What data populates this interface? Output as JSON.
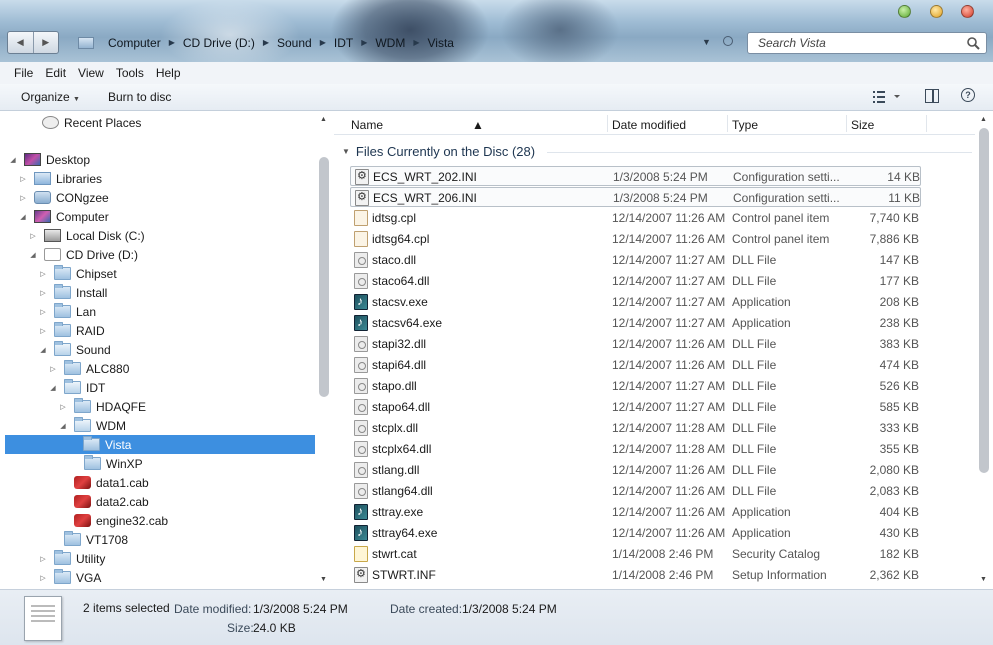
{
  "window": {
    "breadcrumb": [
      "Computer",
      "CD Drive (D:)",
      "Sound",
      "IDT",
      "WDM",
      "Vista"
    ],
    "search_placeholder": "Search Vista"
  },
  "menu": [
    "File",
    "Edit",
    "View",
    "Tools",
    "Help"
  ],
  "toolbar": {
    "organize": "Organize",
    "burn": "Burn to disc"
  },
  "nav": {
    "items": [
      {
        "label": "Recent Places"
      },
      {
        "label": "Desktop"
      },
      {
        "label": "Libraries"
      },
      {
        "label": "CONgzee"
      },
      {
        "label": "Computer"
      },
      {
        "label": "Local Disk (C:)"
      },
      {
        "label": "CD Drive (D:)"
      },
      {
        "label": "Chipset"
      },
      {
        "label": "Install"
      },
      {
        "label": "Lan"
      },
      {
        "label": "RAID"
      },
      {
        "label": "Sound"
      },
      {
        "label": "ALC880"
      },
      {
        "label": "IDT"
      },
      {
        "label": "HDAQFE"
      },
      {
        "label": "WDM"
      },
      {
        "label": "Vista"
      },
      {
        "label": "WinXP"
      },
      {
        "label": "data1.cab"
      },
      {
        "label": "data2.cab"
      },
      {
        "label": "engine32.cab"
      },
      {
        "label": "VT1708"
      },
      {
        "label": "Utility"
      },
      {
        "label": "VGA"
      }
    ]
  },
  "columns": {
    "name": "Name",
    "date": "Date modified",
    "type": "Type",
    "size": "Size"
  },
  "group": {
    "title": "Files Currently on the Disc (28)"
  },
  "files": [
    {
      "name": "ECS_WRT_202.INI",
      "date": "1/3/2008 5:24 PM",
      "type": "Configuration setti...",
      "size": "14 KB",
      "icon": "ini-file-icon"
    },
    {
      "name": "ECS_WRT_206.INI",
      "date": "1/3/2008 5:24 PM",
      "type": "Configuration setti...",
      "size": "11 KB",
      "icon": "ini-file-icon"
    },
    {
      "name": "idtsg.cpl",
      "date": "12/14/2007 11:26 AM",
      "type": "Control panel item",
      "size": "7,740 KB",
      "icon": "cpl-file-icon"
    },
    {
      "name": "idtsg64.cpl",
      "date": "12/14/2007 11:26 AM",
      "type": "Control panel item",
      "size": "7,886 KB",
      "icon": "cpl-file-icon"
    },
    {
      "name": "staco.dll",
      "date": "12/14/2007 11:27 AM",
      "type": "DLL File",
      "size": "147 KB",
      "icon": "dll-file-icon"
    },
    {
      "name": "staco64.dll",
      "date": "12/14/2007 11:27 AM",
      "type": "DLL File",
      "size": "177 KB",
      "icon": "dll-file-icon"
    },
    {
      "name": "stacsv.exe",
      "date": "12/14/2007 11:27 AM",
      "type": "Application",
      "size": "208 KB",
      "icon": "exe-file-icon"
    },
    {
      "name": "stacsv64.exe",
      "date": "12/14/2007 11:27 AM",
      "type": "Application",
      "size": "238 KB",
      "icon": "exe-file-icon"
    },
    {
      "name": "stapi32.dll",
      "date": "12/14/2007 11:26 AM",
      "type": "DLL File",
      "size": "383 KB",
      "icon": "dll-file-icon"
    },
    {
      "name": "stapi64.dll",
      "date": "12/14/2007 11:26 AM",
      "type": "DLL File",
      "size": "474 KB",
      "icon": "dll-file-icon"
    },
    {
      "name": "stapo.dll",
      "date": "12/14/2007 11:27 AM",
      "type": "DLL File",
      "size": "526 KB",
      "icon": "dll-file-icon"
    },
    {
      "name": "stapo64.dll",
      "date": "12/14/2007 11:27 AM",
      "type": "DLL File",
      "size": "585 KB",
      "icon": "dll-file-icon"
    },
    {
      "name": "stcplx.dll",
      "date": "12/14/2007 11:28 AM",
      "type": "DLL File",
      "size": "333 KB",
      "icon": "dll-file-icon"
    },
    {
      "name": "stcplx64.dll",
      "date": "12/14/2007 11:28 AM",
      "type": "DLL File",
      "size": "355 KB",
      "icon": "dll-file-icon"
    },
    {
      "name": "stlang.dll",
      "date": "12/14/2007 11:26 AM",
      "type": "DLL File",
      "size": "2,080 KB",
      "icon": "dll-file-icon"
    },
    {
      "name": "stlang64.dll",
      "date": "12/14/2007 11:26 AM",
      "type": "DLL File",
      "size": "2,083 KB",
      "icon": "dll-file-icon"
    },
    {
      "name": "sttray.exe",
      "date": "12/14/2007 11:26 AM",
      "type": "Application",
      "size": "404 KB",
      "icon": "exe-file-icon"
    },
    {
      "name": "sttray64.exe",
      "date": "12/14/2007 11:26 AM",
      "type": "Application",
      "size": "430 KB",
      "icon": "exe-file-icon"
    },
    {
      "name": "stwrt.cat",
      "date": "1/14/2008 2:46 PM",
      "type": "Security Catalog",
      "size": "182 KB",
      "icon": "cat-file-icon"
    },
    {
      "name": "STWRT.INF",
      "date": "1/14/2008 2:46 PM",
      "type": "Setup Information",
      "size": "2,362 KB",
      "icon": "inf-file-icon"
    }
  ],
  "details": {
    "selected": "2 items selected",
    "date_modified_label": "Date modified:",
    "date_modified": "1/3/2008 5:24 PM",
    "date_created_label": "Date created:",
    "date_created": "1/3/2008 5:24 PM",
    "size_label": "Size:",
    "size": "24.0 KB"
  }
}
